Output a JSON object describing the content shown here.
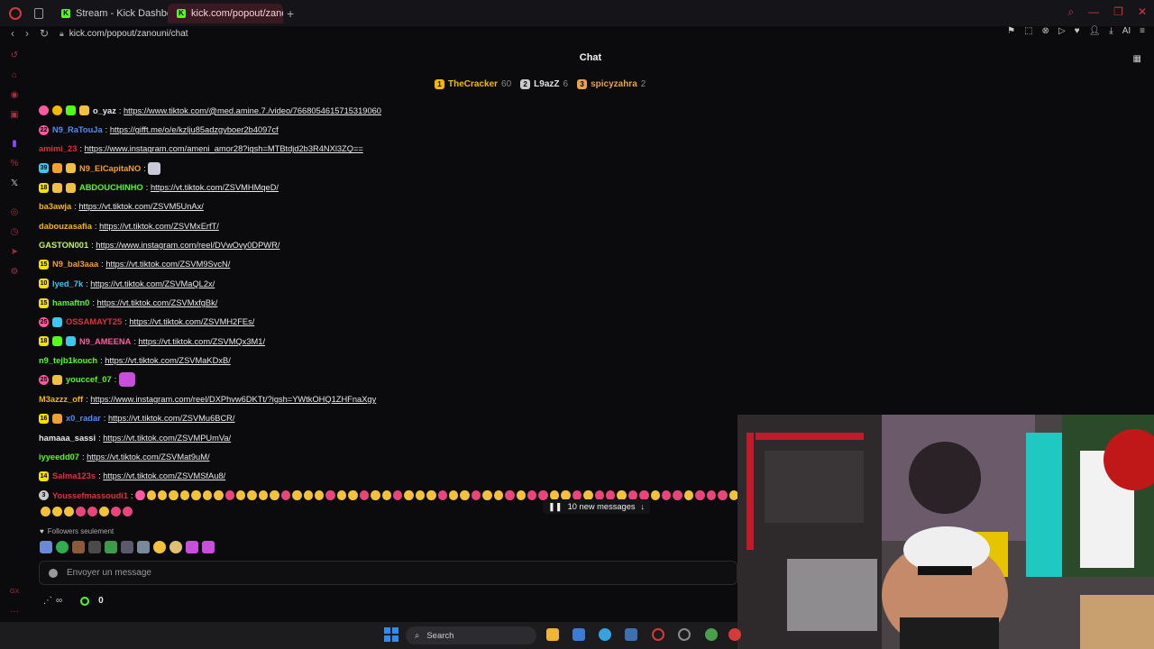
{
  "browser": {
    "tabs": [
      {
        "label": "Stream - Kick Dashboard",
        "active": false
      },
      {
        "label": "kick.com/popout/zanouni/c",
        "active": true
      }
    ],
    "url": "kick.com/popout/zanouni/chat"
  },
  "chat": {
    "title": "Chat",
    "leaderboard": [
      {
        "name": "TheCracker",
        "count": "60",
        "color": "#f5b800"
      },
      {
        "name": "L9azZ",
        "count": "6",
        "color": "#c9c9c9"
      },
      {
        "name": "spicyzahra",
        "count": "2",
        "color": "#e7a24a"
      }
    ],
    "messages": [
      {
        "user": "o_yaz",
        "badge": "",
        "text": "https://www.tiktok.com/@med.amine.7./video/7668054615715319060",
        "color": "#e8e8e8"
      },
      {
        "user": "N9_RaTouJa",
        "badge": "22",
        "text": "https://gifft.me/o/e/kzlju85adzgyboer2b4097cf",
        "color": "#4f8ef7"
      },
      {
        "user": "amimi_23",
        "badge": "",
        "text": "https://www.instagram.com/ameni_amor28?igsh=MTBtdjd2b3R4NXl3ZQ==",
        "color": "#e0303f"
      },
      {
        "user": "N9_ElCapitaNO",
        "badge": "39",
        "text": "",
        "color": "#f0a030"
      },
      {
        "user": "ABDOUCHINHO",
        "badge": "18",
        "text": "https://vt.tiktok.com/ZSVMHMqeD/",
        "color": "#53fc18"
      },
      {
        "user": "ba3awja",
        "badge": "",
        "text": "https://vt.tiktok.com/ZSVM5UnAx/",
        "color": "#f5b800"
      },
      {
        "user": "dabouzasafia",
        "badge": "",
        "text": "https://vt.tiktok.com/ZSVMxErfT/",
        "color": "#f5b800"
      },
      {
        "user": "GASTON001",
        "badge": "",
        "text": "https://www.instagram.com/reel/DVwOvy0DPWR/",
        "color": "#c7f06a"
      },
      {
        "user": "N9_bal3aaa",
        "badge": "15",
        "text": "https://vt.tiktok.com/ZSVM9SvcN/",
        "color": "#f0a030"
      },
      {
        "user": "lyed_7k",
        "badge": "10",
        "text": "https://vt.tiktok.com/ZSVMaQL2x/",
        "color": "#3ec6f0"
      },
      {
        "user": "hamaftn0",
        "badge": "15",
        "text": "https://vt.tiktok.com/ZSVMxfgBk/",
        "color": "#53fc18"
      },
      {
        "user": "OSSAMAYT25",
        "badge": "25",
        "text": "https://vt.tiktok.com/ZSVMH2FEs/",
        "color": "#e0303f"
      },
      {
        "user": "N9_AMEENA",
        "badge": "18",
        "text": "https://vt.tiktok.com/ZSVMQx3M1/",
        "color": "#ff5aa0"
      },
      {
        "user": "n9_tejb1kouch",
        "badge": "",
        "text": "https://vt.tiktok.com/ZSVMaKDxB/",
        "color": "#53fc18"
      },
      {
        "user": "youccef_07",
        "badge": "25",
        "text": "",
        "color": "#53fc18"
      },
      {
        "user": "M3azzz_off",
        "badge": "",
        "text": "https://www.instagram.com/reel/DXPhvw6DKTt/?igsh=YWtkOHQ1ZHFnaXgy",
        "color": "#f5b800"
      },
      {
        "user": "x0_radar",
        "badge": "16",
        "text": "https://vt.tiktok.com/ZSVMu6BCR/",
        "color": "#4f8ef7"
      },
      {
        "user": "hamaaa_sassi",
        "badge": "",
        "text": "https://vt.tiktok.com/ZSVMPUmVa/",
        "color": "#e8e8e8"
      },
      {
        "user": "iyyeedd07",
        "badge": "",
        "text": "https://vt.tiktok.com/ZSVMat9uM/",
        "color": "#53fc18"
      },
      {
        "user": "Salma123s",
        "badge": "14",
        "text": "https://vt.tiktok.com/ZSVMSfAu8/",
        "color": "#e0303f"
      },
      {
        "user": "Youssefmassoudi1",
        "badge": "3",
        "text": "",
        "color": "#e0303f"
      }
    ],
    "new_messages": "10 new messages",
    "followers_only": "Followers seulement",
    "input_placeholder": "Envoyer un message",
    "viewers_label": "∞",
    "points": "0"
  },
  "taskbar": {
    "search_placeholder": "Search"
  }
}
